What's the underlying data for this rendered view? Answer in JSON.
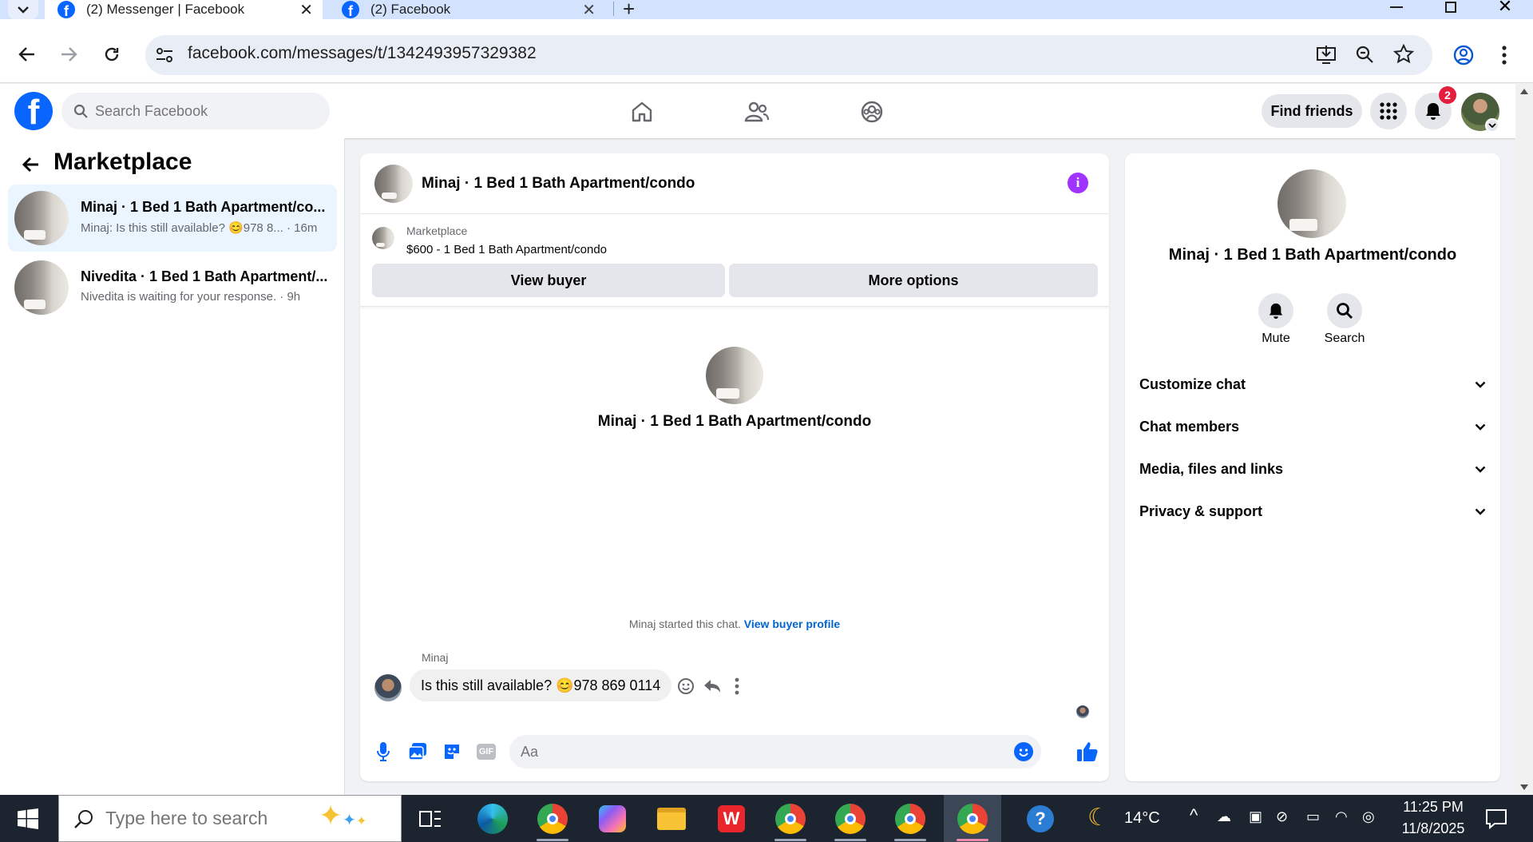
{
  "browser": {
    "tabs": [
      {
        "title": "(2) Messenger | Facebook",
        "active": true
      },
      {
        "title": "(2) Facebook",
        "active": false
      }
    ],
    "url": "facebook.com/messages/t/1342493957329382"
  },
  "fb_header": {
    "search_placeholder": "Search Facebook",
    "find_friends": "Find friends",
    "notification_count": "2"
  },
  "left_panel": {
    "title": "Marketplace",
    "conversations": [
      {
        "title": "Minaj · 1 Bed 1 Bath Apartment/co...",
        "snippet": "Minaj: Is this still available? 😊978 8...",
        "time": "· 16m"
      },
      {
        "title": "Nivedita · 1 Bed 1 Bath Apartment/...",
        "snippet": "Nivedita is waiting for your response.",
        "time": "· 9h"
      }
    ]
  },
  "chat": {
    "title": "Minaj · 1 Bed 1 Bath Apartment/condo",
    "marketplace_label": "Marketplace",
    "listing": "$600 - 1 Bed 1 Bath Apartment/condo",
    "view_buyer": "View buyer",
    "more_options": "More options",
    "intro_name": "Minaj · 1 Bed 1 Bath Apartment/condo",
    "started_text": "Minaj started this chat.",
    "view_buyer_profile": "View buyer profile",
    "sender": "Minaj",
    "message": "Is this still available? 😊978 869 0114",
    "composer_placeholder": "Aa"
  },
  "right_panel": {
    "name": "Minaj · 1 Bed 1 Bath Apartment/condo",
    "mute": "Mute",
    "search": "Search",
    "sections": [
      "Customize chat",
      "Chat members",
      "Media, files and links",
      "Privacy & support"
    ]
  },
  "taskbar": {
    "search_placeholder": "Type here to search",
    "weather": "14°C",
    "time": "11:25 PM",
    "date": "11/8/2025"
  },
  "colors": {
    "fb_blue": "#0866ff",
    "selected_bg": "#ebf5ff",
    "info_purple": "#a033ff",
    "badge_red": "#e41e3f"
  }
}
